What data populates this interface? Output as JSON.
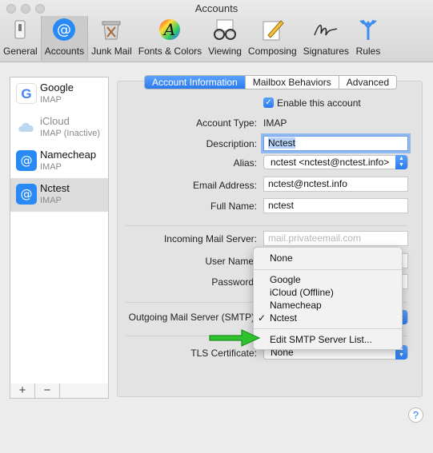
{
  "window": {
    "title": "Accounts"
  },
  "toolbar": {
    "items": [
      {
        "label": "General",
        "icon": "general-switch-icon"
      },
      {
        "label": "Accounts",
        "icon": "at-sign-icon"
      },
      {
        "label": "Junk Mail",
        "icon": "junk-mail-bin-icon"
      },
      {
        "label": "Fonts & Colors",
        "icon": "fonts-colors-icon"
      },
      {
        "label": "Viewing",
        "icon": "glasses-icon"
      },
      {
        "label": "Composing",
        "icon": "composing-pencil-icon"
      },
      {
        "label": "Signatures",
        "icon": "signature-icon"
      },
      {
        "label": "Rules",
        "icon": "rules-arrows-icon"
      }
    ],
    "selected": "Accounts"
  },
  "accounts": [
    {
      "name": "Google",
      "type": "IMAP",
      "icon": "google-icon"
    },
    {
      "name": "iCloud",
      "type": "IMAP (Inactive)",
      "icon": "icloud-icon"
    },
    {
      "name": "Namecheap",
      "type": "IMAP",
      "icon": "at-sign-icon"
    },
    {
      "name": "Nctest",
      "type": "IMAP",
      "icon": "at-sign-icon"
    }
  ],
  "list_footer": {
    "add": "+",
    "remove": "−"
  },
  "tabs": [
    "Account Information",
    "Mailbox Behaviors",
    "Advanced"
  ],
  "form": {
    "enable_label": "Enable this account",
    "account_type_label": "Account Type:",
    "account_type_value": "IMAP",
    "description_label": "Description:",
    "description_value": "Nctest",
    "alias_label": "Alias:",
    "alias_value": "nctest <nctest@nctest.info>",
    "email_label": "Email Address:",
    "email_value": "nctest@nctest.info",
    "fullname_label": "Full Name:",
    "fullname_value": "nctest",
    "incoming_label": "Incoming Mail Server:",
    "incoming_placeholder": "mail.privateemail.com",
    "username_label": "User Name",
    "password_label": "Password",
    "outgoing_label": "Outgoing Mail Server (SMTP)",
    "tls_label": "TLS Certificate:",
    "tls_value": "None"
  },
  "smtp_menu": {
    "items_top": [
      "None"
    ],
    "servers": [
      "Google",
      "iCloud (Offline)",
      "Namecheap",
      "Nctest"
    ],
    "checked": "Nctest",
    "edit": "Edit SMTP Server List...",
    "check_mark": "✓"
  },
  "help": "?",
  "colors": {
    "accent": "#2a7af0",
    "annotation_arrow": "#2ec22e"
  }
}
